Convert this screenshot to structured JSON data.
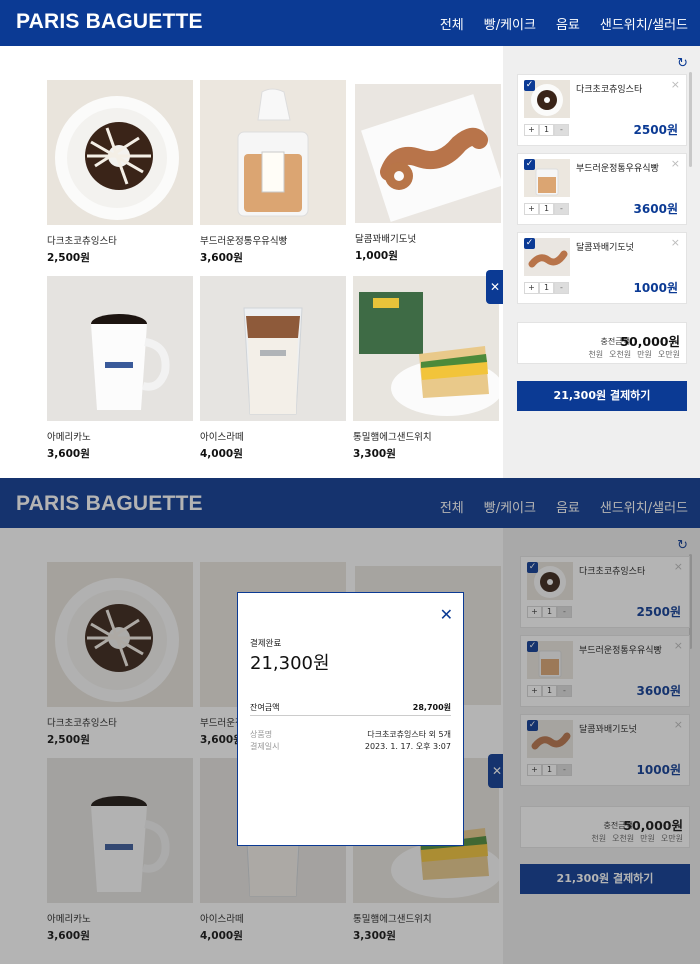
{
  "brand": "PARIS BAGUETTE",
  "nav": [
    "전체",
    "빵/케이크",
    "음료",
    "샌드위치/샐러드"
  ],
  "products": [
    {
      "name": "다크초코츄잉스타",
      "price": "2,500원",
      "icon": "donut-image"
    },
    {
      "name": "부드러운정통우유식빵",
      "price": "3,600원",
      "icon": "bread-image"
    },
    {
      "name": "달콤꽈배기도넛",
      "price": "1,000원",
      "icon": "twist-donut-image"
    },
    {
      "name": "아메리카노",
      "price": "3,600원",
      "icon": "coffee-mug-image"
    },
    {
      "name": "아이스라떼",
      "price": "4,000원",
      "icon": "iced-latte-image"
    },
    {
      "name": "통밀햄에그샌드위치",
      "price": "3,300원",
      "icon": "sandwich-image"
    }
  ],
  "cart": {
    "items": [
      {
        "name": "다크초코츄잉스타",
        "qty": "1",
        "price": "2500원"
      },
      {
        "name": "부드러운정통우유식빵",
        "qty": "1",
        "price": "3600원"
      },
      {
        "name": "달콤꽈배기도넛",
        "qty": "1",
        "price": "1000원"
      }
    ],
    "plus": "+",
    "minus": "-",
    "close": "×",
    "check": "✓",
    "refresh": "↻"
  },
  "charge": {
    "label": "충전금액",
    "amount": "50,000원",
    "options": [
      "천원",
      "오천원",
      "만원",
      "오만원"
    ]
  },
  "pay_button": "21,300원 결제하기",
  "side_toggle": "✕",
  "modal": {
    "close": "✕",
    "title": "결제완료",
    "amount": "21,300원",
    "balance_label": "잔여금액",
    "balance_value": "28,700원",
    "product_label": "상품명",
    "product_value": "다크초코츄잉스타 외 5개",
    "date_label": "결제일시",
    "date_value": "2023. 1. 17. 오후 3:07"
  },
  "colors": {
    "brand": "#0b3a94",
    "sidebar": "#efefef"
  }
}
